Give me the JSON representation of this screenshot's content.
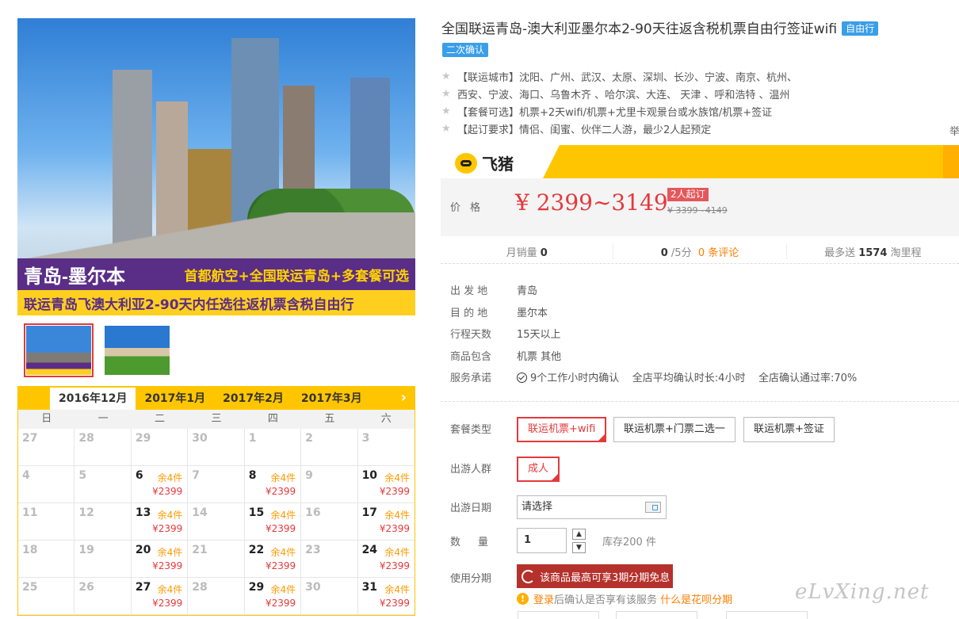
{
  "hero": {
    "banner_left": "青岛-墨尔本",
    "banner_right": "首都航空+全国联运青岛+多套餐可选",
    "banner_bottom": "联运青岛飞澳大利亚2-90天内任选往返机票含税自由行"
  },
  "calendar": {
    "months": [
      "2016年12月",
      "2017年1月",
      "2017年2月",
      "2017年3月"
    ],
    "active_month": 0,
    "next_icon": "›",
    "weekdays": [
      "日",
      "一",
      "二",
      "三",
      "四",
      "五",
      "六"
    ],
    "days": [
      {
        "d": "27"
      },
      {
        "d": "28"
      },
      {
        "d": "29"
      },
      {
        "d": "30"
      },
      {
        "d": "1"
      },
      {
        "d": "2"
      },
      {
        "d": "3"
      },
      {
        "d": "4"
      },
      {
        "d": "5"
      },
      {
        "d": "6",
        "stock": "余4件",
        "price": "¥2399"
      },
      {
        "d": "7"
      },
      {
        "d": "8",
        "stock": "余4件",
        "price": "¥2399"
      },
      {
        "d": "9"
      },
      {
        "d": "10",
        "stock": "余4件",
        "price": "¥2399"
      },
      {
        "d": "11"
      },
      {
        "d": "12"
      },
      {
        "d": "13",
        "stock": "余4件",
        "price": "¥2399"
      },
      {
        "d": "14"
      },
      {
        "d": "15",
        "stock": "余4件",
        "price": "¥2399"
      },
      {
        "d": "16"
      },
      {
        "d": "17",
        "stock": "余4件",
        "price": "¥2399"
      },
      {
        "d": "18"
      },
      {
        "d": "19"
      },
      {
        "d": "20",
        "stock": "余4件",
        "price": "¥2399"
      },
      {
        "d": "21"
      },
      {
        "d": "22",
        "stock": "余4件",
        "price": "¥2399"
      },
      {
        "d": "23"
      },
      {
        "d": "24",
        "stock": "余4件",
        "price": "¥2399"
      },
      {
        "d": "25"
      },
      {
        "d": "26"
      },
      {
        "d": "27",
        "stock": "余4件",
        "price": "¥2399"
      },
      {
        "d": "28"
      },
      {
        "d": "29",
        "stock": "余4件",
        "price": "¥2399"
      },
      {
        "d": "30"
      },
      {
        "d": "31",
        "stock": "余4件",
        "price": "¥2399"
      }
    ]
  },
  "product": {
    "title": "全国联运青岛-澳大利亚墨尔本2-90天往返含税机票自由行签证wifi",
    "tag_free": "自由行",
    "tag_confirm": "二次确认",
    "features": [
      "【联运城市】沈阳、广州、武汉、太原、深圳、长沙、宁波、南京、杭州、",
      "西安、宁波、海口、乌鲁木齐 、哈尔滨、大连、 天津 、呼和浩特 、温州",
      "【套餐可选】机票+2天wifi/机票+尤里卡观景台或水族馆/机票+签证",
      "【起订要求】情侣、闺蜜、伙伴二人游，最少2人起预定"
    ],
    "edge_char": "举"
  },
  "price": {
    "brand": "飞猪",
    "label": "价格",
    "value": "¥ 2399~3149",
    "badge": "2人起订",
    "original": "¥ 3399~4149"
  },
  "stats": {
    "monthly_label": "月销量",
    "monthly_value": "0",
    "rating_value": "0",
    "rating_suffix": "/5分",
    "reviews": "0 条评论",
    "miles_prefix": "最多送",
    "miles_value": "1574",
    "miles_suffix": "淘里程"
  },
  "info": [
    {
      "k": "出 发 地",
      "v": "青岛"
    },
    {
      "k": "目 的 地",
      "v": "墨尔本"
    },
    {
      "k": "行程天数",
      "v": "15天以上"
    },
    {
      "k": "商品包含",
      "v": "机票  其他"
    },
    {
      "k": "服务承诺",
      "v": "9个工作小时内确认    全店平均确认时长:4小时    全店确认通过率:70%"
    }
  ],
  "options": {
    "package_label": "套餐类型",
    "packages": [
      "联运机票+wifi",
      "联运机票+门票二选一",
      "联运机票+签证"
    ],
    "people_label": "出游人群",
    "people": [
      "成人"
    ],
    "date_label": "出游日期",
    "date_placeholder": "请选择",
    "qty_label": "数量",
    "qty_value": "1",
    "stock": "库存200 件",
    "installment_label": "使用分期",
    "installment_button": "该商品最高可享3期分期免息",
    "notice_link": "登录",
    "notice_text": "后确认是否享有该服务",
    "notice_what": "什么是花呗分期"
  },
  "watermark": "eLvXing.net"
}
